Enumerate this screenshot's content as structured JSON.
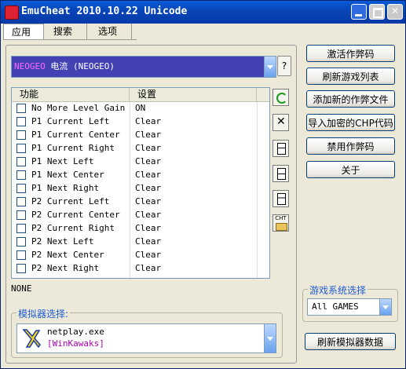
{
  "window": {
    "title": "EmuCheat 2010.10.22 Unicode"
  },
  "tabs": [
    {
      "label": "应用"
    },
    {
      "label": "搜索"
    },
    {
      "label": "选项"
    }
  ],
  "game_select": {
    "value_prefix": "NEOGEO",
    "value_rest": " 电流 (NEOGEO)"
  },
  "help_label": "?",
  "table": {
    "headers": [
      "功能",
      "设置"
    ],
    "rows": [
      {
        "name": "No More Level Gain",
        "value": "ON"
      },
      {
        "name": "P1 Current Left",
        "value": "Clear"
      },
      {
        "name": "P1 Current Center",
        "value": "Clear"
      },
      {
        "name": "P1 Current Right",
        "value": "Clear"
      },
      {
        "name": "P1 Next Left",
        "value": "Clear"
      },
      {
        "name": "P1 Next Center",
        "value": "Clear"
      },
      {
        "name": "P1 Next Right",
        "value": "Clear"
      },
      {
        "name": "P2 Current Left",
        "value": "Clear"
      },
      {
        "name": "P2 Current Center",
        "value": "Clear"
      },
      {
        "name": "P2 Current Right",
        "value": "Clear"
      },
      {
        "name": "P2 Next Left",
        "value": "Clear"
      },
      {
        "name": "P2 Next Center",
        "value": "Clear"
      },
      {
        "name": "P2 Next Right",
        "value": "Clear"
      }
    ]
  },
  "tool_icon_cht": "CHT",
  "status": "NONE",
  "emulator": {
    "group_title": "模拟器选择:",
    "name": "netplay.exe",
    "sub": "[WinKawaks]"
  },
  "system": {
    "group_title": "游戏系统选择",
    "value": "All GAMES"
  },
  "buttons": {
    "activate": "激活作弊码",
    "refresh_list": "刷新游戏列表",
    "add_file": "添加新的作弊文件",
    "import_chp": "导入加密的CHP代码",
    "disable": "禁用作弊码",
    "about": "关于",
    "refresh_emu": "刷新模拟器数据"
  }
}
